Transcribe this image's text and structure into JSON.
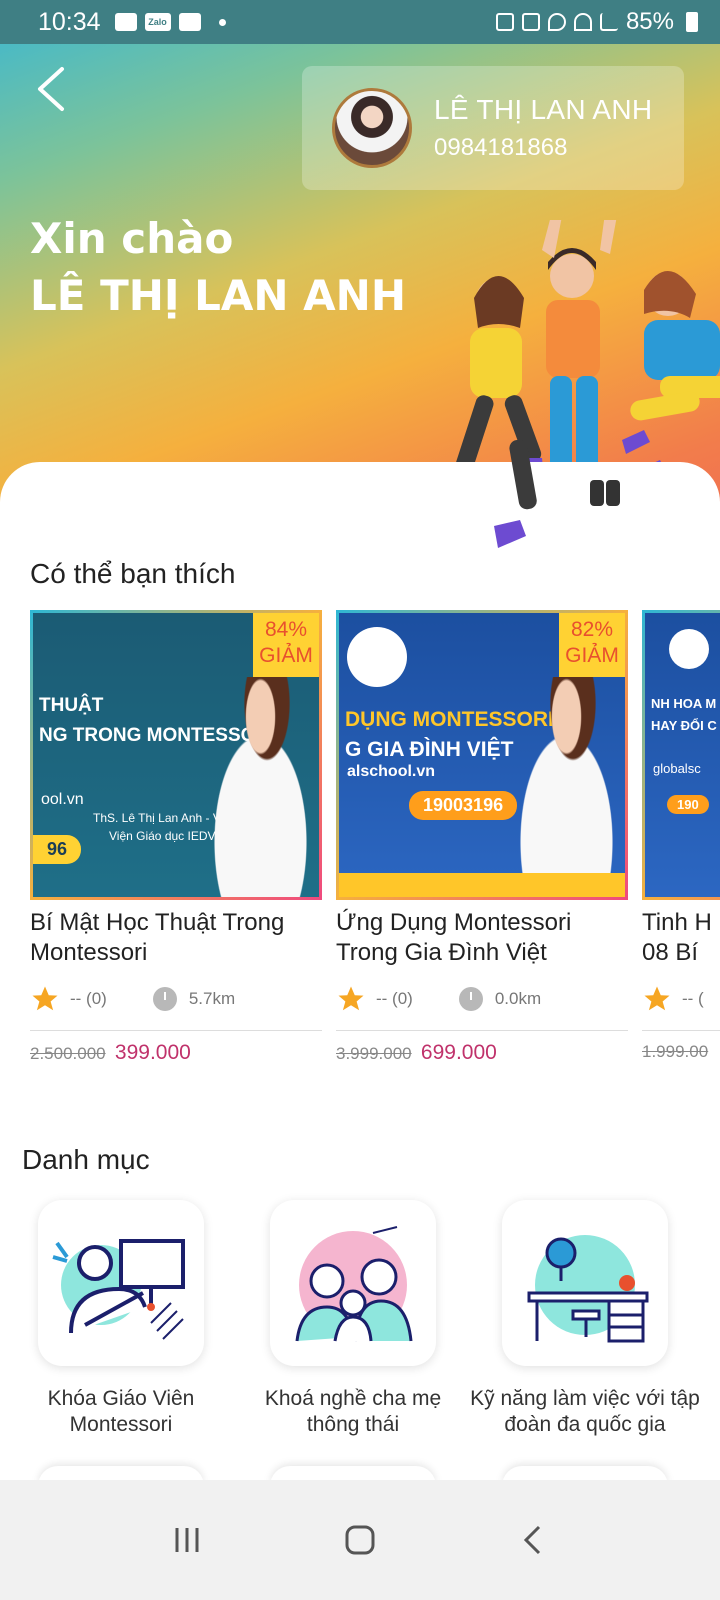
{
  "status_bar": {
    "time": "10:34",
    "battery": "85%",
    "icons_left": [
      "gallery-icon",
      "zalo-icon",
      "youtube-icon",
      "dot"
    ],
    "icons_right": [
      "battery-saver-icon",
      "mute-icon",
      "location-icon",
      "wifi-icon",
      "signal-icon",
      "battery-icon"
    ]
  },
  "header": {
    "user_name": "LÊ THỊ LAN ANH",
    "phone": "0984181868",
    "greeting_line1": "Xin chào",
    "greeting_line2": "LÊ THỊ LAN ANH"
  },
  "recommend": {
    "title": "Có thể bạn thích",
    "courses": [
      {
        "title": "Bí Mật Học Thuật Trong Montessori",
        "discount_pct": "84%",
        "discount_label": "GIẢM",
        "rating": "-- (0)",
        "distance": "5.7km",
        "old_price": "2.500.000",
        "new_price": "399.000",
        "thumb_line1": "THUẬT",
        "thumb_line2": "NG TRONG MONTESSORI",
        "thumb_url": "ool.vn",
        "thumb_author": "ThS. Lê Thị Lan Anh - Viện trưởng",
        "thumb_org": "Viện Giáo dục IEDV",
        "thumb_phone": "96"
      },
      {
        "title": "Ứng Dụng Montessori Trong Gia Đình Việt",
        "discount_pct": "82%",
        "discount_label": "GIẢM",
        "rating": "-- (0)",
        "distance": "0.0km",
        "old_price": "3.999.000",
        "new_price": "699.000",
        "thumb_line1": "DỤNG MONTESSORI",
        "thumb_line2": "G GIA ĐÌNH VIỆT",
        "thumb_url": "alschool.vn",
        "thumb_phone": "19003196"
      },
      {
        "title": "Tinh H",
        "title_line2": "08 Bí",
        "rating": "-- (",
        "old_price": "1.999.00",
        "thumb_line1": "NH HOA M",
        "thumb_line2": "HAY ĐỔI C",
        "thumb_url": "globalsc",
        "thumb_phone": "190"
      }
    ]
  },
  "categories": {
    "title": "Danh mục",
    "items": [
      {
        "label": "Khóa Giáo Viên Montessori",
        "icon": "teacher-icon"
      },
      {
        "label": "Khoá nghề cha mẹ thông thái",
        "icon": "family-icon"
      },
      {
        "label": "Kỹ năng làm việc với tập đoàn đa quốc gia",
        "icon": "workdesk-icon"
      }
    ]
  },
  "colors": {
    "accent_price": "#c0326b",
    "discount_bg": "#ffd233",
    "discount_text": "#e8502e",
    "star": "#f6a623"
  }
}
